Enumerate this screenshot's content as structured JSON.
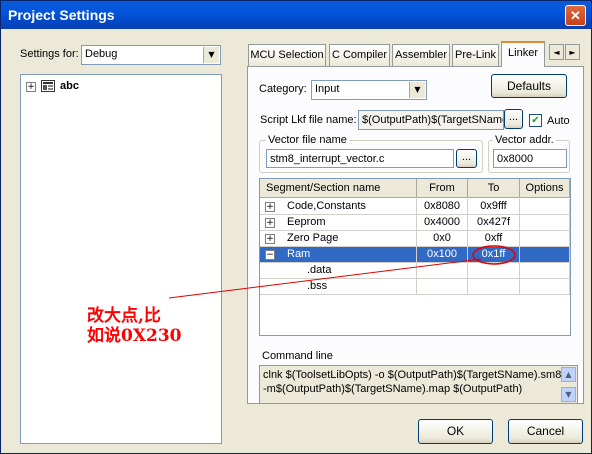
{
  "window": {
    "title": "Project Settings",
    "close_glyph": "✕"
  },
  "settings_for": {
    "label": "Settings for:",
    "value": "Debug"
  },
  "tree": {
    "root_label": "abc",
    "expander": "+"
  },
  "tabs": [
    {
      "label": "MCU Selection"
    },
    {
      "label": "C Compiler"
    },
    {
      "label": "Assembler"
    },
    {
      "label": "Pre-Link"
    },
    {
      "label": "Linker"
    }
  ],
  "tab_scroll": {
    "left": "◄",
    "right": "►"
  },
  "linker": {
    "category_label": "Category:",
    "category_value": "Input",
    "defaults_label": "Defaults",
    "script_label": "Script Lkf file name:",
    "script_value": "$(OutputPath)$(TargetSName",
    "browse_label": "...",
    "auto_label": "Auto",
    "auto_checked": "✔",
    "vector_file_label": "Vector file name",
    "vector_file_value": "stm8_interrupt_vector.c",
    "vector_addr_label": "Vector addr.",
    "vector_addr_value": "0x8000"
  },
  "segments": {
    "columns": [
      "Segment/Section name",
      "From",
      "To",
      "Options"
    ],
    "rows": [
      {
        "expander": "+",
        "name": "Code,Constants",
        "from": "0x8080",
        "to": "0x9fff",
        "options": ""
      },
      {
        "expander": "+",
        "name": "Eeprom",
        "from": "0x4000",
        "to": "0x427f",
        "options": ""
      },
      {
        "expander": "+",
        "name": "Zero Page",
        "from": "0x0",
        "to": "0xff",
        "options": ""
      },
      {
        "expander": "−",
        "name": "Ram",
        "from": "0x100",
        "to": "0x1ff",
        "options": ""
      },
      {
        "expander": "",
        "name": ".data",
        "from": "",
        "to": "",
        "options": ""
      },
      {
        "expander": "",
        "name": ".bss",
        "from": "",
        "to": "",
        "options": ""
      }
    ],
    "selected_row": 3
  },
  "command_line": {
    "label": "Command line",
    "line1": "clnk $(ToolsetLibOpts) -o $(OutputPath)$(TargetSName).sm8",
    "line2": "-m$(OutputPath)$(TargetSName).map $(OutputPath)",
    "scroll_up": "▲",
    "scroll_down": "▼"
  },
  "buttons": {
    "ok": "OK",
    "cancel": "Cancel"
  },
  "annotation": {
    "line1": "改大点,比",
    "line2": "如说0X230",
    "color": "#ff0000"
  }
}
